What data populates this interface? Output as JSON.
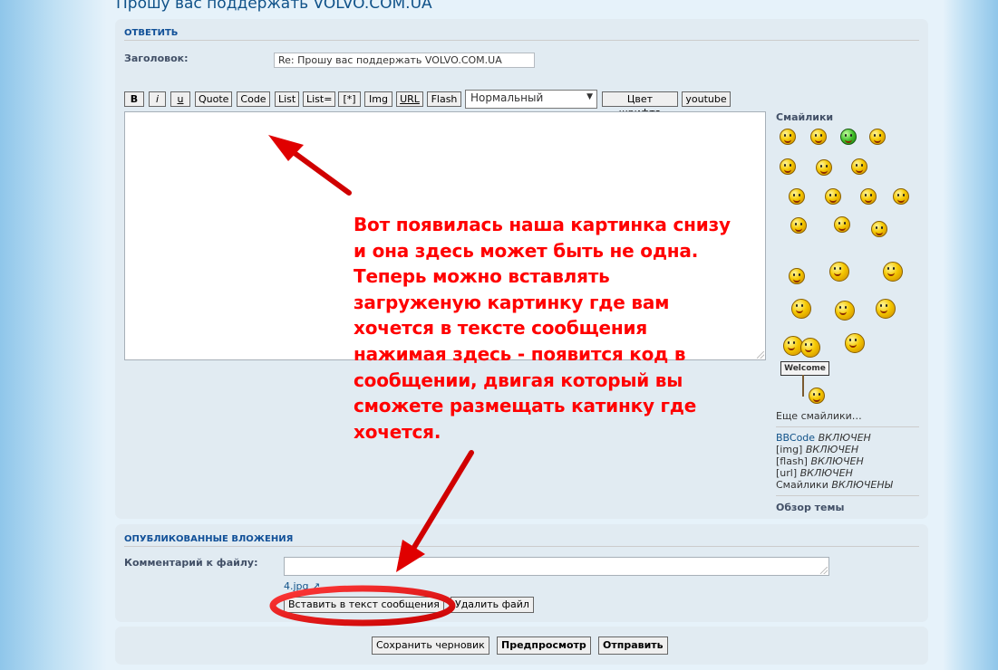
{
  "page": {
    "topic_title": "Прошу вас поддержать VOLVO.COM.UA"
  },
  "reply": {
    "heading": "ОТВЕТИТЬ",
    "subject_label": "Заголовок:",
    "subject_value": "Re: Прошу вас поддержать VOLVO.COM.UA",
    "toolbar": {
      "bold": "B",
      "italic": "i",
      "underline": "u",
      "quote": "Quote",
      "code": "Code",
      "list": "List",
      "list_ordered": "List=",
      "list_item": "[*]",
      "img": "Img",
      "url": "URL",
      "flash": "Flash",
      "font_size": "Нормальный",
      "font_color": "Цвет шрифта",
      "youtube": "youtube"
    },
    "message_value": ""
  },
  "sidebar": {
    "smilies_title": "Смайлики",
    "welcome_text": "Welcome",
    "more_smilies": "Еще смайлики…",
    "bbcode_link": "BBCode",
    "bbcode_status": "ВКЛЮЧЕН",
    "img_label": "[img]",
    "img_status": "ВКЛЮЧЕН",
    "flash_label": "[flash]",
    "flash_status": "ВКЛЮЧЕН",
    "url_label": "[url]",
    "url_status": "ВКЛЮЧЕН",
    "smilies_label": "Смайлики",
    "smilies_status": "ВКЛЮЧЕНЫ",
    "topic_review": "Обзор темы"
  },
  "attachments": {
    "heading": "ОПУБЛИКОВАННЫЕ ВЛОЖЕНИЯ",
    "comment_label": "Комментарий к файлу:",
    "file_name": "4.jpg",
    "insert_button": "Вставить в текст сообщения",
    "delete_button": "Удалить файл"
  },
  "submit": {
    "save_draft": "Сохранить черновик",
    "preview": "Предпросмотр",
    "send": "Отправить"
  },
  "annotation": {
    "lines": [
      "Вот появилась наша картинка снизу",
      "и она здесь может быть не одна.",
      "Теперь можно вставлять",
      "загруженую картинку где вам",
      "хочется в тексте сообщения",
      "нажимая здесь - появится код в",
      "сообщении, двигая который вы",
      "сможете размещать катинку где",
      "хочется."
    ]
  },
  "colors": {
    "annotation": "#ff0000",
    "panel": "#e1ebf2",
    "heading": "#115098",
    "link": "#105289"
  }
}
